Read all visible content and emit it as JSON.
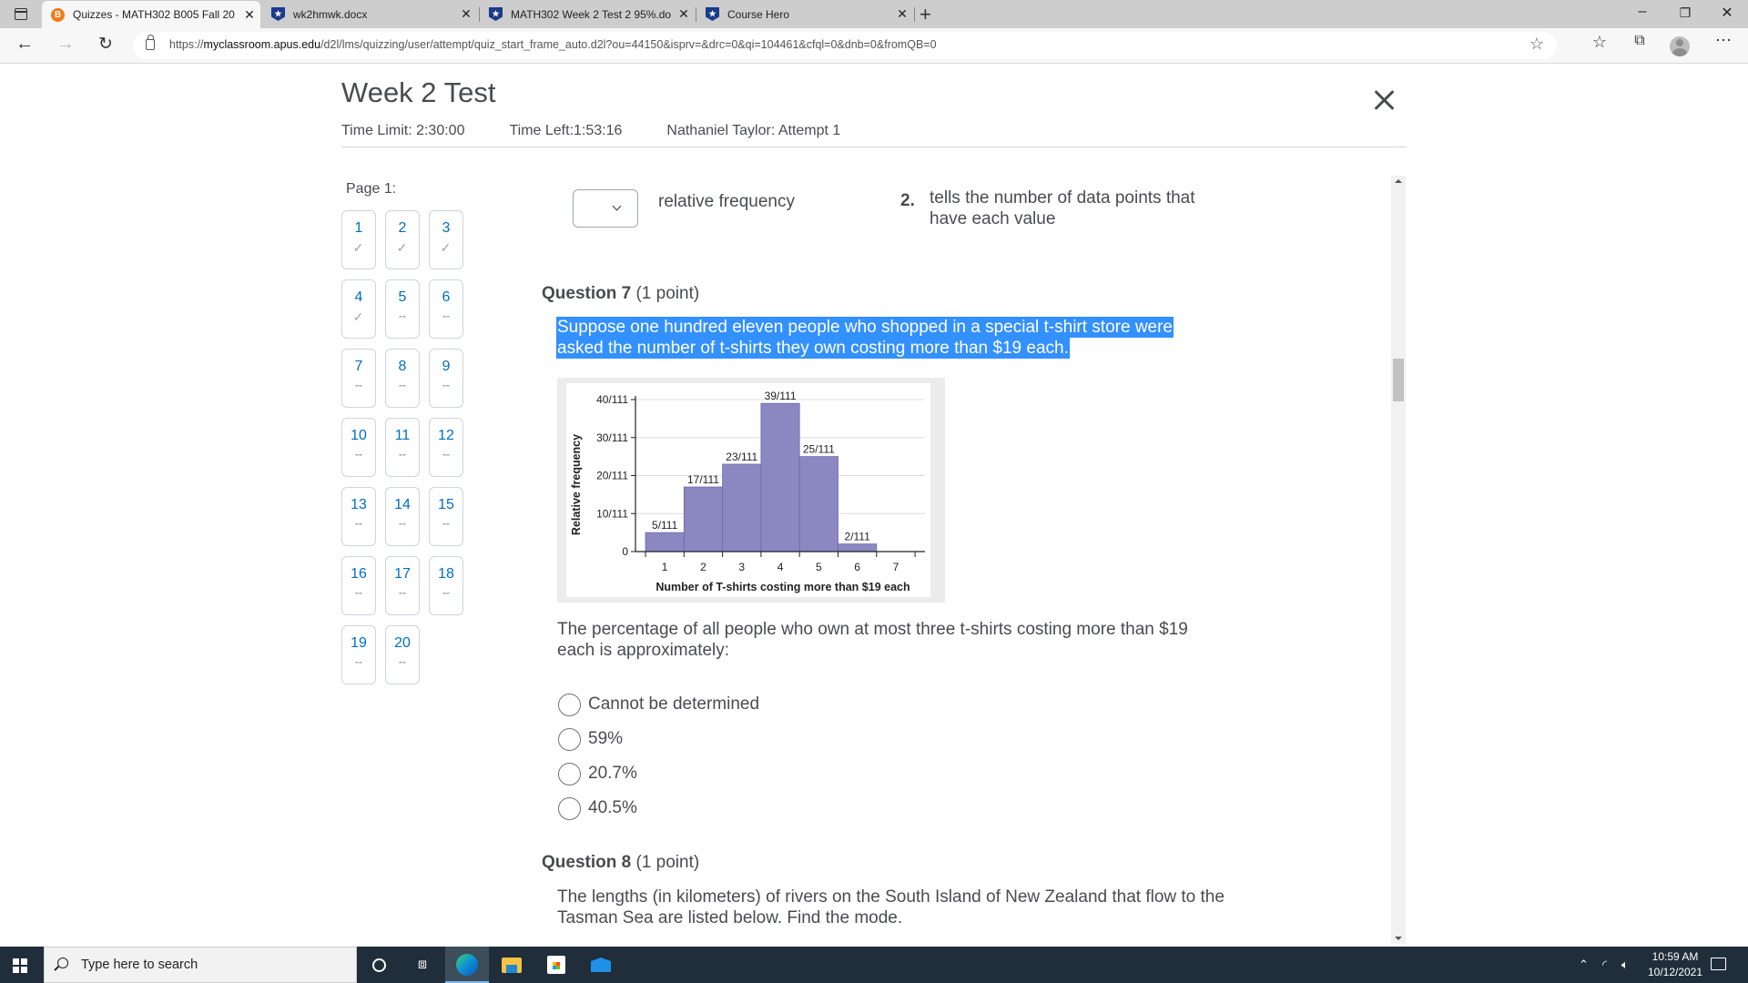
{
  "browser": {
    "tabs": [
      {
        "label": "Quizzes - MATH302 B005 Fall 20",
        "icon": "brightspace-icon",
        "active": true
      },
      {
        "label": "wk2hmwk.docx",
        "icon": "coursehero-shield-icon",
        "active": false
      },
      {
        "label": "MATH302 Week 2 Test 2 95%.do",
        "icon": "coursehero-shield-icon",
        "active": false
      },
      {
        "label": "Course Hero",
        "icon": "coursehero-shield-icon",
        "active": false
      }
    ],
    "new_tab_label": "+",
    "url_prefix": "https://",
    "url_domain": "myclassroom.apus.edu",
    "url_path": "/d2l/lms/quizzing/user/attempt/quiz_start_frame_auto.d2l?ou=44150&isprv=&drc=0&qi=104461&cfql=0&dnb=0&fromQB=0",
    "window_controls": {
      "minimize": "–",
      "restore": "❐",
      "close": "✕"
    }
  },
  "quiz": {
    "title": "Week 2 Test",
    "time_limit": "Time Limit: 2:30:00",
    "time_left": "Time Left:1:53:16",
    "attempt": "Nathaniel Taylor: Attempt 1",
    "page_label": "Page 1:",
    "questions_palette": [
      {
        "num": "1",
        "status": "✓"
      },
      {
        "num": "2",
        "status": "✓"
      },
      {
        "num": "3",
        "status": "✓"
      },
      {
        "num": "4",
        "status": "✓"
      },
      {
        "num": "5",
        "status": "--"
      },
      {
        "num": "6",
        "status": "--"
      },
      {
        "num": "7",
        "status": "--"
      },
      {
        "num": "8",
        "status": "--"
      },
      {
        "num": "9",
        "status": "--"
      },
      {
        "num": "10",
        "status": "--"
      },
      {
        "num": "11",
        "status": "--"
      },
      {
        "num": "12",
        "status": "--"
      },
      {
        "num": "13",
        "status": "--"
      },
      {
        "num": "14",
        "status": "--"
      },
      {
        "num": "15",
        "status": "--"
      },
      {
        "num": "16",
        "status": "--"
      },
      {
        "num": "17",
        "status": "--"
      },
      {
        "num": "18",
        "status": "--"
      },
      {
        "num": "19",
        "status": "--"
      },
      {
        "num": "20",
        "status": "--"
      }
    ]
  },
  "matching": {
    "selected_value": "",
    "term": "relative frequency",
    "def_number": "2.",
    "definition": "tells the number of data points that have each value"
  },
  "question7": {
    "heading": "Question 7",
    "points": "(1 point)",
    "stem": "Suppose one hundred eleven people who shopped in a special t-shirt store were asked the number of t-shirts they own costing more than $19 each.",
    "prompt": "The percentage of all people who own at most three t-shirts costing more than $19 each is approximately:",
    "options": [
      "Cannot be determined",
      "59%",
      "20.7%",
      "40.5%"
    ]
  },
  "question8": {
    "heading": "Question 8",
    "points": "(1 point)",
    "stem": "The lengths (in kilometers) of rivers on the South Island of New Zealand that flow to the Tasman Sea are listed below. Find the mode."
  },
  "chart_data": {
    "type": "bar",
    "title": "",
    "xlabel": "Number of T-shirts costing more than $19 each",
    "ylabel": "Relative frequency",
    "categories": [
      "1",
      "2",
      "3",
      "4",
      "5",
      "6",
      "7"
    ],
    "values": [
      0.045,
      0.153,
      0.207,
      0.351,
      0.225,
      0.018,
      0
    ],
    "data_labels": [
      "5/111",
      "17/111",
      "23/111",
      "39/111",
      "25/111",
      "2/111",
      ""
    ],
    "yticks": [
      0,
      0.09,
      0.18,
      0.27,
      0.36
    ],
    "ytick_labels": [
      "0",
      "10/111",
      "20/111",
      "30/111",
      "40/111"
    ],
    "ylim": [
      0,
      0.36
    ],
    "grid": true,
    "bar_color": "#8a87c1",
    "legend": "none"
  },
  "taskbar": {
    "search_placeholder": "Type here to search",
    "time": "10:59 AM",
    "date": "10/12/2021"
  }
}
